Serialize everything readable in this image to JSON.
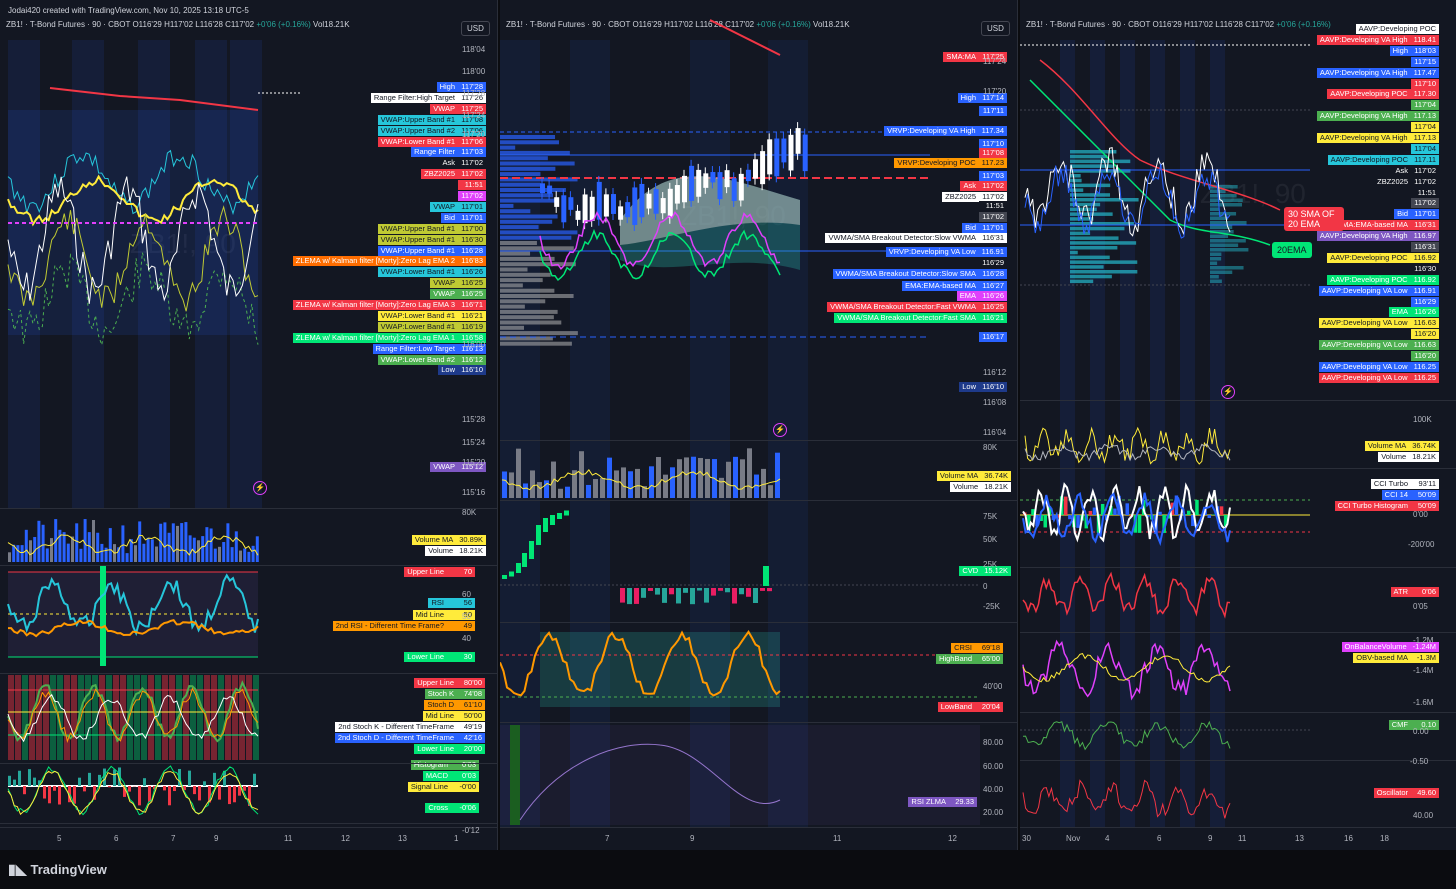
{
  "credit": "Jodai420 created with TradingView.com, Nov 10, 2025 13:18 UTC-5",
  "brand": "TradingView",
  "currency": "USD",
  "header": {
    "symbol": "ZB1! · T-Bond Futures · 90 · CBOT",
    "o": "O116'29",
    "h": "H117'02",
    "l": "L116'28",
    "c": "C117'02",
    "chg": "+0'06 (+0.16%)",
    "vol": "Vol18.21K"
  },
  "watermark": {
    "big": "ZB1!, 90",
    "sub": "T-Bond Futures"
  },
  "left": {
    "price_axis": [
      "118'04",
      "118'00",
      "117'28",
      "117'24",
      "117'20",
      "116'00",
      "115'28",
      "115'24",
      "115'20",
      "115'16"
    ],
    "tags": [
      {
        "n": "High",
        "v": "117'28",
        "c": "#2962ff"
      },
      {
        "n": "Range Filter:High Target",
        "v": "117'26",
        "c": "#ffffff"
      },
      {
        "n": "VWAP",
        "v": "117'25",
        "c": "#f23645"
      },
      {
        "n": "VWAP:Upper Band #1",
        "v": "117'08",
        "c": "#26c6da"
      },
      {
        "n": "VWAP:Upper Band #2",
        "v": "117'06",
        "c": "#26c6da"
      },
      {
        "n": "VWAP:Lower Band #1",
        "v": "117'06",
        "c": "#f23645"
      },
      {
        "n": "Range Filter",
        "v": "117'03",
        "c": "#2962ff"
      },
      {
        "n": "Ask",
        "v": "117'02",
        "c": "#131722"
      },
      {
        "n": "ZBZ2025",
        "v": "117'02",
        "c": "#f23645"
      },
      {
        "n": "",
        "v": "11:51",
        "c": "#f23645"
      },
      {
        "n": "",
        "v": "117'02",
        "c": "#e040fb"
      },
      {
        "n": "VWAP",
        "v": "117'01",
        "c": "#26c6da"
      },
      {
        "n": "Bid",
        "v": "117'01",
        "c": "#2962ff"
      },
      {
        "n": "VWAP:Upper Band #1",
        "v": "117'00",
        "c": "#c0ca33"
      },
      {
        "n": "VWAP:Upper Band #1",
        "v": "116'30",
        "c": "#c0ca33"
      },
      {
        "n": "VWAP:Upper Band #1",
        "v": "116'28",
        "c": "#2962ff"
      },
      {
        "n": "ZLEMA w/ Kalman filter [Morty]:Zero Lag EMA 2",
        "v": "116'83",
        "c": "#ff6d00"
      },
      {
        "n": "VWAP:Lower Band #1",
        "v": "116'26",
        "c": "#26c6da"
      },
      {
        "n": "VWAP",
        "v": "116'25",
        "c": "#c0ca33"
      },
      {
        "n": "VWAP",
        "v": "116'25",
        "c": "#4caf50"
      },
      {
        "n": "ZLEMA w/ Kalman filter [Morty]:Zero Lag EMA 3",
        "v": "116'71",
        "c": "#f23645"
      },
      {
        "n": "VWAP:Lower Band #1",
        "v": "116'21",
        "c": "#ffeb3b"
      },
      {
        "n": "VWAP:Lower Band #1",
        "v": "116'19",
        "c": "#c0ca33"
      },
      {
        "n": "ZLEMA w/ Kalman filter [Morty]:Zero Lag EMA 1",
        "v": "116'58",
        "c": "#00e676"
      },
      {
        "n": "Range Filter:Low Target",
        "v": "116'13",
        "c": "#2962ff"
      },
      {
        "n": "VWAP:Lower Band #2",
        "v": "116'12",
        "c": "#4caf50"
      },
      {
        "n": "Low",
        "v": "116'10",
        "c": "#1e3a8a"
      },
      {
        "n": "VWAP",
        "v": "115'12",
        "c": "#7e57c2"
      }
    ],
    "volume": {
      "axis": "80K",
      "tags": [
        {
          "n": "Volume MA",
          "v": "30.89K",
          "c": "#ffeb3b"
        },
        {
          "n": "Volume",
          "v": "18.21K",
          "c": "#ffffff"
        }
      ]
    },
    "rsi": {
      "axis": [
        "60",
        "50",
        "40"
      ],
      "tags": [
        {
          "n": "Upper Line",
          "v": "70",
          "c": "#f23645"
        },
        {
          "n": "RSI",
          "v": "56",
          "c": "#26c6da"
        },
        {
          "n": "Mid Line",
          "v": "50",
          "c": "#ffeb3b"
        },
        {
          "n": "2nd RSI - Different Time Frame?",
          "v": "49",
          "c": "#ff9800"
        },
        {
          "n": "Lower Line",
          "v": "30",
          "c": "#00e676"
        }
      ]
    },
    "stoch": {
      "tags": [
        {
          "n": "Upper Line",
          "v": "80'00",
          "c": "#f23645"
        },
        {
          "n": "Stoch K",
          "v": "74'08",
          "c": "#4caf50"
        },
        {
          "n": "Stoch D",
          "v": "61'10",
          "c": "#ff9800"
        },
        {
          "n": "Mid Line",
          "v": "50'00",
          "c": "#ffeb3b"
        },
        {
          "n": "2nd Stoch K - Different TimeFrame",
          "v": "49'19",
          "c": "#ffffff"
        },
        {
          "n": "2nd Stoch D - Different TimeFrame",
          "v": "42'16",
          "c": "#2962ff"
        },
        {
          "n": "Lower Line",
          "v": "20'00",
          "c": "#00e676"
        }
      ]
    },
    "macd": {
      "axis": "-0'12",
      "tags": [
        {
          "n": "Histogram",
          "v": "0'03",
          "c": "#4caf50"
        },
        {
          "n": "MACD",
          "v": "0'03",
          "c": "#00e676"
        },
        {
          "n": "Signal Line",
          "v": "-0'00",
          "c": "#ffeb3b"
        },
        {
          "n": "Cross",
          "v": "-0'06",
          "c": "#00e676"
        }
      ]
    },
    "x_ticks": [
      "5",
      "6",
      "7",
      "9",
      "11",
      "12",
      "13",
      "1"
    ]
  },
  "middle": {
    "price_axis": [
      "117'24",
      "117'20",
      "116'12",
      "116'08",
      "116'04"
    ],
    "tags": [
      {
        "n": "SMA:MA",
        "v": "117'25",
        "c": "#f23645"
      },
      {
        "n": "High",
        "v": "117'14",
        "c": "#2962ff"
      },
      {
        "n": "",
        "v": "117'11",
        "c": "#2962ff"
      },
      {
        "n": "VRVP:Developing VA High",
        "v": "117.34",
        "c": "#2962ff"
      },
      {
        "n": "",
        "v": "117'10",
        "c": "#2962ff"
      },
      {
        "n": "",
        "v": "117'08",
        "c": "#f23645"
      },
      {
        "n": "VRVP:Developing POC",
        "v": "117.23",
        "c": "#ff9800"
      },
      {
        "n": "",
        "v": "117'03",
        "c": "#2962ff"
      },
      {
        "n": "Ask",
        "v": "117'02",
        "c": "#f23645"
      },
      {
        "n": "ZBZ2025",
        "v": "117'02",
        "c": "#ffffff"
      },
      {
        "n": "",
        "v": "11:51",
        "c": "#131722"
      },
      {
        "n": "",
        "v": "117'02",
        "c": "#434651"
      },
      {
        "n": "Bid",
        "v": "117'01",
        "c": "#2962ff"
      },
      {
        "n": "VWMA/SMA Breakout Detector:Slow VWMA",
        "v": "116'31",
        "c": "#ffffff"
      },
      {
        "n": "VRVP:Developing VA Low",
        "v": "116.91",
        "c": "#2962ff"
      },
      {
        "n": "",
        "v": "116'29",
        "c": "#131722"
      },
      {
        "n": "VWMA/SMA Breakout Detector:Slow SMA",
        "v": "116'28",
        "c": "#2962ff"
      },
      {
        "n": "EMA:EMA-based MA",
        "v": "116'27",
        "c": "#2962ff"
      },
      {
        "n": "EMA",
        "v": "116'26",
        "c": "#e040fb"
      },
      {
        "n": "VWMA/SMA Breakout Detector:Fast VWMA",
        "v": "116'25",
        "c": "#f23645"
      },
      {
        "n": "VWMA/SMA Breakout Detector:Fast SMA",
        "v": "116'21",
        "c": "#00e676"
      },
      {
        "n": "",
        "v": "116'17",
        "c": "#2962ff"
      },
      {
        "n": "Low",
        "v": "116'10",
        "c": "#1e3a8a"
      }
    ],
    "volume": {
      "axis": "80K",
      "tags": [
        {
          "n": "Volume MA",
          "v": "36.74K",
          "c": "#ffeb3b"
        },
        {
          "n": "Volume",
          "v": "18.21K",
          "c": "#ffffff"
        }
      ]
    },
    "cvd": {
      "axis": [
        "75K",
        "50K",
        "25K",
        "0",
        "-25K"
      ],
      "tags": [
        {
          "n": "CVD",
          "v": "15.12K",
          "c": "#00e676"
        }
      ]
    },
    "crsi": {
      "axis": [
        "40'00"
      ],
      "tags": [
        {
          "n": "CRSI",
          "v": "69'18",
          "c": "#ff9800"
        },
        {
          "n": "HighBand",
          "v": "65'00",
          "c": "#4caf50"
        },
        {
          "n": "LowBand",
          "v": "20'04",
          "c": "#f23645"
        }
      ]
    },
    "rsi_zlma": {
      "axis": [
        "80.00",
        "60.00",
        "40.00",
        "20.00"
      ],
      "tags": [
        {
          "n": "RSI ZLMA",
          "v": "29.33",
          "c": "#7e57c2"
        }
      ]
    },
    "x_ticks": [
      "7",
      "9",
      "11",
      "12"
    ]
  },
  "right": {
    "tags": [
      {
        "n": "AAVP:Developing POC",
        "v": "",
        "c": "#ffffff"
      },
      {
        "n": "AAVP:Developing VA High",
        "v": "118.41",
        "c": "#f23645"
      },
      {
        "n": "High",
        "v": "118'03",
        "c": "#2962ff"
      },
      {
        "n": "",
        "v": "117'15",
        "c": "#2962ff"
      },
      {
        "n": "AAVP:Developing VA High",
        "v": "117.47",
        "c": "#2962ff"
      },
      {
        "n": "",
        "v": "117'10",
        "c": "#f23645"
      },
      {
        "n": "AAVP:Developing POC",
        "v": "117.30",
        "c": "#f23645"
      },
      {
        "n": "",
        "v": "117'04",
        "c": "#4caf50"
      },
      {
        "n": "AAVP:Developing VA High",
        "v": "117.13",
        "c": "#4caf50"
      },
      {
        "n": "",
        "v": "117'04",
        "c": "#ffeb3b"
      },
      {
        "n": "AAVP:Developing VA High",
        "v": "117.13",
        "c": "#ffeb3b"
      },
      {
        "n": "",
        "v": "117'04",
        "c": "#26c6da"
      },
      {
        "n": "AAVP:Developing POC",
        "v": "117.11",
        "c": "#26c6da"
      },
      {
        "n": "Ask",
        "v": "117'02",
        "c": "#131722"
      },
      {
        "n": "ZBZ2025",
        "v": "117'02",
        "c": "#131722"
      },
      {
        "n": "",
        "v": "11:51",
        "c": "#131722"
      },
      {
        "n": "",
        "v": "117'02",
        "c": "#434651"
      },
      {
        "n": "Bid",
        "v": "117'01",
        "c": "#2962ff"
      },
      {
        "n": "EMA:EMA-based MA",
        "v": "116'31",
        "c": "#f23645"
      },
      {
        "n": "AAVP:Developing VA High",
        "v": "116.97",
        "c": "#7e57c2"
      },
      {
        "n": "",
        "v": "116'31",
        "c": "#434651"
      },
      {
        "n": "AAVP:Developing POC",
        "v": "116.92",
        "c": "#ffeb3b"
      },
      {
        "n": "",
        "v": "116'30",
        "c": "#131722"
      },
      {
        "n": "AAVP:Developing POC",
        "v": "116.92",
        "c": "#00e676"
      },
      {
        "n": "AAVP:Developing VA Low",
        "v": "116.91",
        "c": "#2962ff"
      },
      {
        "n": "",
        "v": "116'29",
        "c": "#2962ff"
      },
      {
        "n": "EMA",
        "v": "116'26",
        "c": "#00e676"
      },
      {
        "n": "AAVP:Developing VA Low",
        "v": "116.63",
        "c": "#ffeb3b"
      },
      {
        "n": "",
        "v": "116'20",
        "c": "#ffeb3b"
      },
      {
        "n": "AAVP:Developing VA Low",
        "v": "116.63",
        "c": "#4caf50"
      },
      {
        "n": "",
        "v": "116'20",
        "c": "#4caf50"
      },
      {
        "n": "AAVP:Developing VA Low",
        "v": "116.25",
        "c": "#2962ff"
      },
      {
        "n": "AAVP:Developing VA Low",
        "v": "116.25",
        "c": "#f23645"
      }
    ],
    "annotations": {
      "sma": "30 SMA OF 20 EMA",
      "ema": "20EMA"
    },
    "volume": {
      "axis": "100K",
      "tags": [
        {
          "n": "Volume MA",
          "v": "36.74K",
          "c": "#ffeb3b"
        },
        {
          "n": "Volume",
          "v": "18.21K",
          "c": "#ffffff"
        }
      ]
    },
    "cci": {
      "axis": [
        "0'00",
        "-200'00"
      ],
      "tags": [
        {
          "n": "CCI Turbo",
          "v": "93'11",
          "c": "#ffffff"
        },
        {
          "n": "CCI 14",
          "v": "50'09",
          "c": "#2962ff"
        },
        {
          "n": "CCI Turbo Histogram",
          "v": "50'09",
          "c": "#f23645"
        }
      ]
    },
    "atr": {
      "axis": [
        "0'05"
      ],
      "tags": [
        {
          "n": "ATR",
          "v": "0'06",
          "c": "#f23645"
        }
      ]
    },
    "obv": {
      "axis": [
        "-1.2M",
        "-1.4M",
        "-1.6M"
      ],
      "tags": [
        {
          "n": "OnBalanceVolume",
          "v": "-1.24M",
          "c": "#e040fb"
        },
        {
          "n": "OBV-based MA",
          "v": "-1.3M",
          "c": "#ffeb3b"
        }
      ]
    },
    "cmf": {
      "axis": [
        "0.00",
        "-0.50"
      ],
      "tags": [
        {
          "n": "CMF",
          "v": "0.10",
          "c": "#4caf50"
        }
      ]
    },
    "osc": {
      "axis": [
        "40.00"
      ],
      "tags": [
        {
          "n": "Oscillator",
          "v": "49.60",
          "c": "#f23645"
        }
      ]
    },
    "x_ticks": [
      "30",
      "Nov",
      "4",
      "6",
      "9",
      "11",
      "13",
      "16",
      "18"
    ]
  }
}
